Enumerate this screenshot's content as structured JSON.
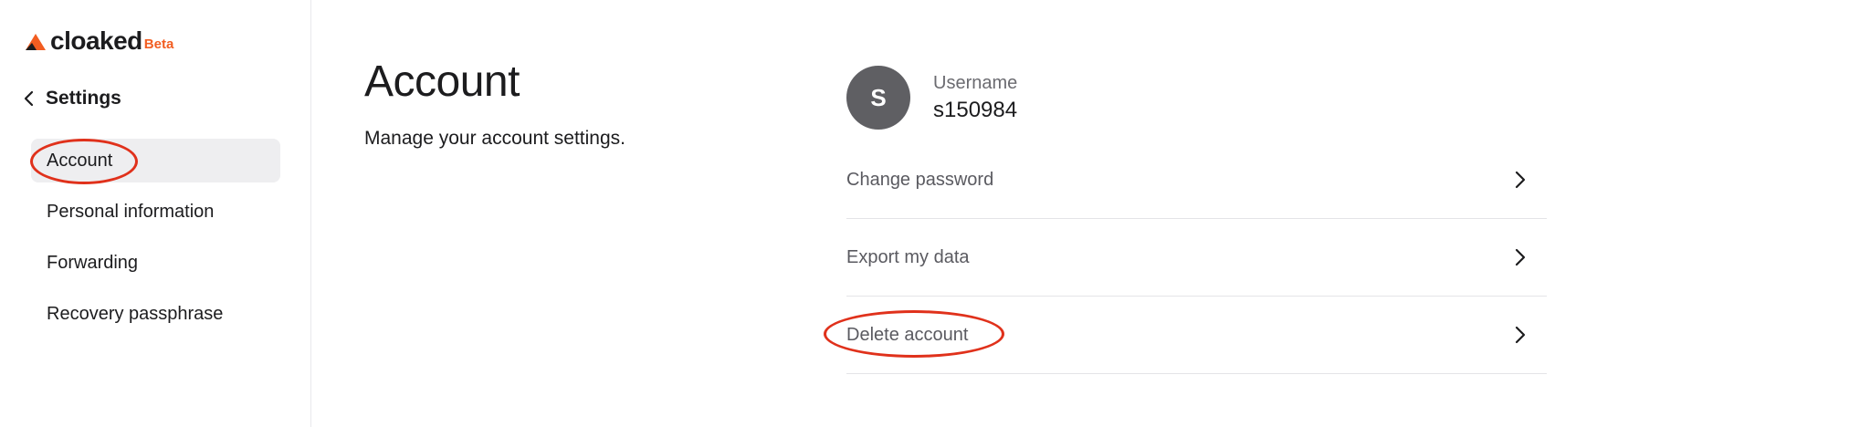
{
  "brand": {
    "name": "cloaked",
    "badge": "Beta",
    "accent_color": "#f25d21"
  },
  "sidebar": {
    "back_label": "Settings",
    "items": [
      {
        "label": "Account",
        "active": true
      },
      {
        "label": "Personal information",
        "active": false
      },
      {
        "label": "Forwarding",
        "active": false
      },
      {
        "label": "Recovery passphrase",
        "active": false
      }
    ]
  },
  "main": {
    "title": "Account",
    "subtitle": "Manage your account settings."
  },
  "user": {
    "avatar_initial": "S",
    "label": "Username",
    "value": "s150984"
  },
  "actions": [
    {
      "label": "Change password",
      "icon": "chevron-right-icon"
    },
    {
      "label": "Export my data",
      "icon": "chevron-right-icon"
    },
    {
      "label": "Delete account",
      "icon": "chevron-right-icon"
    }
  ],
  "annotations": {
    "color": "#e0311b",
    "highlighted": [
      "Account",
      "Delete account"
    ]
  }
}
